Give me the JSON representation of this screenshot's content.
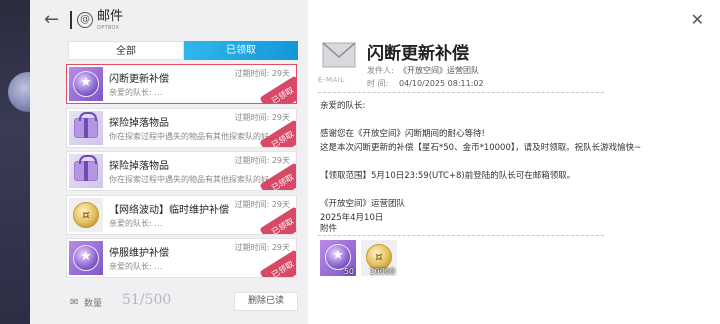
{
  "header": {
    "back_icon": "back-arrow-icon",
    "title": "邮件",
    "subtitle": "OPTBOX"
  },
  "tabs": [
    {
      "label": "全部",
      "active": false
    },
    {
      "label": "已领取",
      "active": true
    }
  ],
  "mails": [
    {
      "title": "闪断更新补偿",
      "expiry": "过期时间: 29天",
      "preview": "亲爱的队长: …",
      "icon": "star-badge-icon",
      "stamp": "已领取",
      "selected": true
    },
    {
      "title": "探险掉落物品",
      "expiry": "过期时间: 29天",
      "preview": "你在探索过程中遇失的物品有其他探索队的好…",
      "icon": "gift-box-icon",
      "stamp": "已领取",
      "selected": false
    },
    {
      "title": "探险掉落物品",
      "expiry": "过期时间: 29天",
      "preview": "你在探索过程中遇失的物品有其他探索队的好…",
      "icon": "gift-box-icon",
      "stamp": "已领取",
      "selected": false
    },
    {
      "title": "【网络波动】临时维护补偿",
      "expiry": "过期时间: 29天",
      "preview": "亲爱的队长: …",
      "icon": "gold-coin-icon",
      "stamp": "已领取",
      "selected": false
    },
    {
      "title": "停服维护补偿",
      "expiry": "过期时间: 29天",
      "preview": "亲爱的队长: …",
      "icon": "star-badge-icon",
      "stamp": "已领取",
      "selected": false
    }
  ],
  "footer": {
    "count_label": "数量",
    "count_value": "51/500",
    "delete_label": "删除已读"
  },
  "detail": {
    "envelope_label": "E-MAIL",
    "title": "闪断更新补偿",
    "sender_key": "发件人:",
    "sender": "《开放空间》运营团队",
    "time_key": "时  间:",
    "time": "04/10/2025 08:11:02",
    "greeting": "亲爱的队长:",
    "line1": "感谢您在《开放空间》闪断期间的耐心等待!",
    "line2": "这是本次闪断更新的补偿【星石*50、金币*10000】，请及时领取。祝队长游戏愉快~",
    "line3": "【领取范围】5月10日23:59(UTC+8)前登陆的队长可在邮箱领取。",
    "sign1": "《开放空间》运营团队",
    "sign2": "2025年4月10日",
    "attachments_label": "附件",
    "attachments": [
      {
        "icon": "star-stone-icon",
        "count": "50"
      },
      {
        "icon": "gold-coin-icon",
        "count": "10000"
      }
    ]
  },
  "colors": {
    "accent": "#1a9fdc",
    "stamp": "#d43a5a",
    "selected_border": "#e24c67"
  }
}
